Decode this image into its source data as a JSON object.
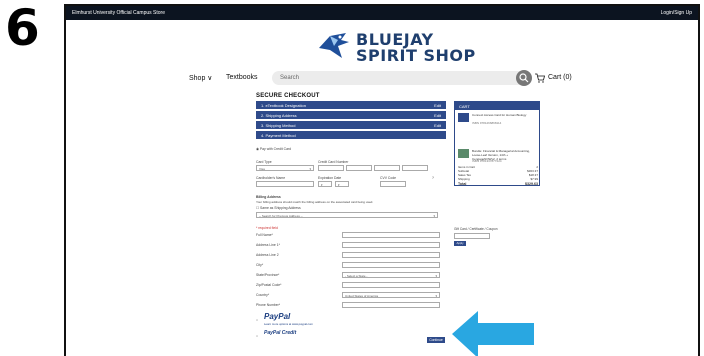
{
  "step_number": "6",
  "topbar": {
    "store": "Elmhurst University Official Campus Store",
    "login": "Login/Sign Up"
  },
  "logo": {
    "line1": "BLUEJAY",
    "line2": "SPIRIT SHOP"
  },
  "nav": {
    "shop": "Shop ∨",
    "textbooks": "Textbooks",
    "search_placeholder": "Search",
    "cart": "Cart (0)"
  },
  "checkout": {
    "title": "SECURE CHECKOUT",
    "steps": [
      {
        "label": "1. eTextbook Designation",
        "edit": "Edit"
      },
      {
        "label": "2. Shipping Address",
        "edit": "Edit"
      },
      {
        "label": "3. Shipping Method",
        "edit": "Edit"
      },
      {
        "label": "4. Payment Method",
        "edit": ""
      }
    ]
  },
  "payment": {
    "pay_with_card": "Pay with Credit Card",
    "card_type": "Card Type",
    "card_type_value": "Visa",
    "card_number": "Credit Card Number",
    "holder": "Cardholder's Name",
    "expiration": "Expiration Date",
    "cvv": "CVV Code",
    "billing_title": "Billing Address",
    "billing_note": "Your billing address should match the billing address on the associated card being used.",
    "same_as_shipping": "Same as Shipping Address",
    "prev_address": "-- Search for Previous Address --",
    "required": "* required field",
    "fields": [
      "Full Name*",
      "Address Line 1*",
      "Address Line 2",
      "City*",
      "State/Province*",
      "Zip/Postal Code*",
      "Country*",
      "Phone Number*"
    ],
    "state_placeholder": "- Select a State -",
    "country_value": "United States of America",
    "paypal": "PayPal",
    "paypal_note": "Learn more options at www.paypal.com",
    "credit": "PayPal Credit",
    "continue": "Continue"
  },
  "cart": {
    "title": "CART",
    "items": [
      {
        "name": "Connect Access Card for Human Biology",
        "meta": "ISBN 9781266868114"
      },
      {
        "name": "Bundle: Financial & Managerial Accounting, Loose-Leaf Version, 14th + CengageNOWv2, 2 terms",
        "meta": "ISBN 9781337877224"
      }
    ],
    "items_in_cart_label": "Items in Cart",
    "items_in_cart_value": "2",
    "subtotal_label": "Subtotal",
    "subtotal_value": "$303.37",
    "sales_tax_label": "Sales Tax",
    "sales_tax_value": "$18.37",
    "shipping_label": "Shipping",
    "shipping_value": "$7.99",
    "total_label": "Total",
    "total_value": "$329.63"
  },
  "gift": {
    "label": "Gift Card / Certificate / Coupon",
    "apply": "Apply"
  },
  "colors": {
    "primary": "#2e4a8a",
    "arrow": "#29a7e1"
  }
}
